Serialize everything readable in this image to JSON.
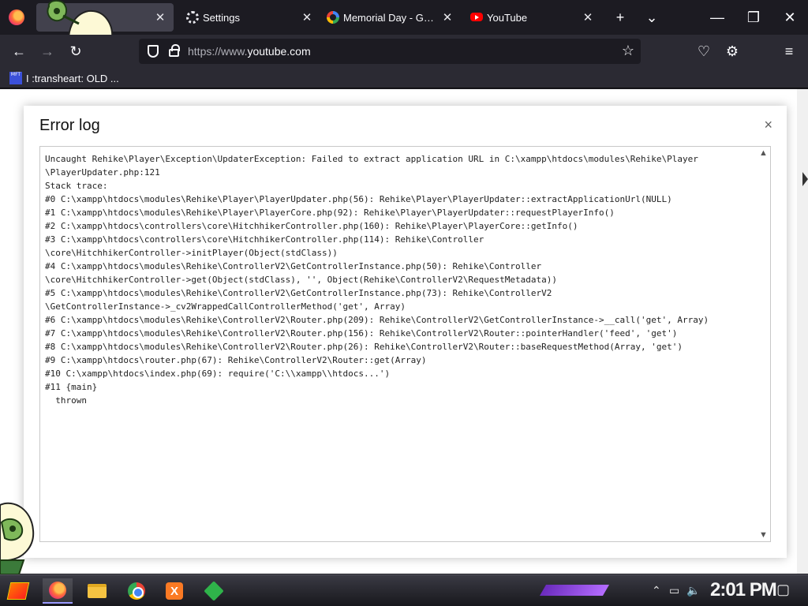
{
  "tabs": [
    {
      "label": "",
      "close": "✕"
    },
    {
      "label": "Settings",
      "close": "✕"
    },
    {
      "label": "Memorial Day - Google Search",
      "close": "✕"
    },
    {
      "label": "YouTube",
      "close": "✕"
    }
  ],
  "tabstrip": {
    "new_tab": "+",
    "list_all": "⌄"
  },
  "window_controls": {
    "minimize": "—",
    "restore": "❐",
    "close": "✕"
  },
  "nav": {
    "back": "←",
    "forward": "→",
    "reload": "↻",
    "url_prefix": "https://www.",
    "url_domain": "youtube.com",
    "bookmark": "☆",
    "pocket": "♡",
    "extensions": "⚙",
    "menu": "≡"
  },
  "bookmarks": [
    {
      "icon": "MFT",
      "label": "I :transheart: OLD ..."
    }
  ],
  "modal": {
    "title": "Error log",
    "close": "×",
    "log": "Uncaught Rehike\\Player\\Exception\\UpdaterException: Failed to extract application URL in C:\\xampp\\htdocs\\modules\\Rehike\\Player\n\\PlayerUpdater.php:121\nStack trace:\n#0 C:\\xampp\\htdocs\\modules\\Rehike\\Player\\PlayerUpdater.php(56): Rehike\\Player\\PlayerUpdater::extractApplicationUrl(NULL)\n#1 C:\\xampp\\htdocs\\modules\\Rehike\\Player\\PlayerCore.php(92): Rehike\\Player\\PlayerUpdater::requestPlayerInfo()\n#2 C:\\xampp\\htdocs\\controllers\\core\\HitchhikerController.php(160): Rehike\\Player\\PlayerCore::getInfo()\n#3 C:\\xampp\\htdocs\\controllers\\core\\HitchhikerController.php(114): Rehike\\Controller\n\\core\\HitchhikerController->initPlayer(Object(stdClass))\n#4 C:\\xampp\\htdocs\\modules\\Rehike\\ControllerV2\\GetControllerInstance.php(50): Rehike\\Controller\n\\core\\HitchhikerController->get(Object(stdClass), '', Object(Rehike\\ControllerV2\\RequestMetadata))\n#5 C:\\xampp\\htdocs\\modules\\Rehike\\ControllerV2\\GetControllerInstance.php(73): Rehike\\ControllerV2\n\\GetControllerInstance->_cv2WrappedCallControllerMethod('get', Array)\n#6 C:\\xampp\\htdocs\\modules\\Rehike\\ControllerV2\\Router.php(209): Rehike\\ControllerV2\\GetControllerInstance->__call('get', Array)\n#7 C:\\xampp\\htdocs\\modules\\Rehike\\ControllerV2\\Router.php(156): Rehike\\ControllerV2\\Router::pointerHandler('feed', 'get')\n#8 C:\\xampp\\htdocs\\modules\\Rehike\\ControllerV2\\Router.php(26): Rehike\\ControllerV2\\Router::baseRequestMethod(Array, 'get')\n#9 C:\\xampp\\htdocs\\router.php(67): Rehike\\ControllerV2\\Router::get(Array)\n#10 C:\\xampp\\htdocs\\index.php(69): require('C:\\\\xampp\\\\htdocs...')\n#11 {main}\n  thrown",
    "scroll_up": "▲",
    "scroll_down": "▼"
  },
  "taskbar": {
    "xampp_label": "X",
    "tray_chevron": "⌃",
    "tray_network": "▭",
    "tray_volume": "🔈",
    "clock": "2:01 PM",
    "notifications": "▢"
  },
  "colors": {
    "tab_active": "#42414d",
    "toolbar": "#2b2a33",
    "frame": "#1c1b22",
    "modal_bg": "#ffffff"
  }
}
